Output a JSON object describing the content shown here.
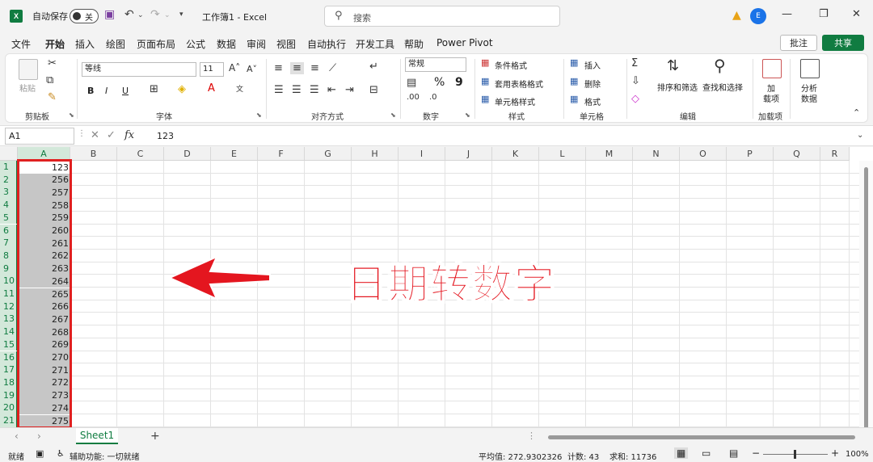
{
  "titlebar": {
    "autosave_label": "自动保存",
    "toggle_state": "关",
    "doc_title": "工作簿1  -  Excel",
    "search_placeholder": "搜索",
    "avatar": "E"
  },
  "menu": {
    "tabs": [
      "文件",
      "开始",
      "插入",
      "绘图",
      "页面布局",
      "公式",
      "数据",
      "审阅",
      "视图",
      "自动执行",
      "开发工具",
      "帮助",
      "Power Pivot"
    ],
    "active_tab": "开始",
    "comment": "批注",
    "share": "共享"
  },
  "ribbon": {
    "clipboard": {
      "paste": "粘贴",
      "label": "剪贴板"
    },
    "font": {
      "name": "等线",
      "size": "11",
      "label": "字体",
      "bold": "B",
      "italic": "I",
      "underline": "U"
    },
    "align": {
      "label": "对齐方式"
    },
    "number": {
      "format": "常规",
      "percent": "%",
      "comma": "9",
      "label": "数字"
    },
    "styles": {
      "cond": "条件格式",
      "table": "套用表格格式",
      "cell": "单元格样式",
      "label": "样式"
    },
    "cells": {
      "insert": "插入",
      "delete": "删除",
      "format": "格式",
      "label": "单元格"
    },
    "editing": {
      "sort": "排序和筛选",
      "find": "查找和选择",
      "label": "编辑"
    },
    "addins": {
      "btn_line1": "加",
      "btn_line2": "载项",
      "label": "加载项"
    },
    "analyze": {
      "line1": "分析",
      "line2": "数据"
    }
  },
  "formula_bar": {
    "name_box": "A1",
    "fx": "fx",
    "formula": "123"
  },
  "grid": {
    "columns": [
      "A",
      "B",
      "C",
      "D",
      "E",
      "F",
      "G",
      "H",
      "I",
      "J",
      "K",
      "L",
      "M",
      "N",
      "O",
      "P",
      "Q",
      "R"
    ],
    "rows": [
      "1",
      "2",
      "3",
      "4",
      "5",
      "6",
      "7",
      "8",
      "9",
      "10",
      "11",
      "12",
      "13",
      "14",
      "15",
      "16",
      "17",
      "18",
      "19",
      "20",
      "21"
    ],
    "column_a_values": [
      "123",
      "256",
      "257",
      "258",
      "259",
      "260",
      "261",
      "262",
      "263",
      "264",
      "265",
      "266",
      "267",
      "268",
      "269",
      "270",
      "271",
      "272",
      "273",
      "274",
      "275"
    ]
  },
  "overlay": {
    "text": "日期转数字"
  },
  "sheets": {
    "active": "Sheet1",
    "add": "+"
  },
  "status": {
    "ready": "就绪",
    "accessibility": "辅助功能: 一切就绪",
    "average": "平均值: 272.9302326",
    "count": "计数: 43",
    "sum": "求和: 11736",
    "zoom": "100%"
  },
  "colors": {
    "accent": "#107c41",
    "highlight_red": "#e02020"
  }
}
